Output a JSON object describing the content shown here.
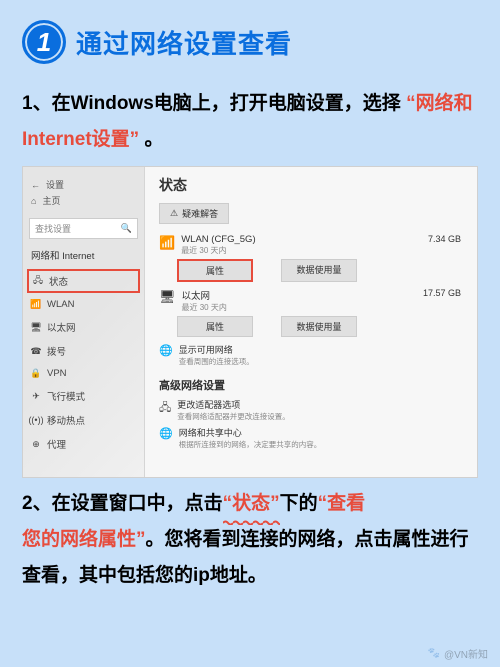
{
  "heading": {
    "number": "1",
    "text": "通过网络设置查看"
  },
  "step1": {
    "prefix": "1、在Windows电脑上，打开电脑设置，选择",
    "highlight": "“网络和Internet设置”",
    "suffix": "。"
  },
  "screenshot": {
    "top": {
      "back": "←",
      "title": "设置",
      "home_icon": "⌂",
      "home": "主页"
    },
    "search_placeholder": "查找设置",
    "category": "网络和 Internet",
    "sidebar_items": [
      {
        "icon": "🖧",
        "label": "状态",
        "active": true
      },
      {
        "icon": "📶",
        "label": "WLAN"
      },
      {
        "icon": "🖥",
        "label": "以太网"
      },
      {
        "icon": "☎",
        "label": "拨号"
      },
      {
        "icon": "🔒",
        "label": "VPN"
      },
      {
        "icon": "✈",
        "label": "飞行模式"
      },
      {
        "icon": "((•))",
        "label": "移动热点"
      },
      {
        "icon": "⊕",
        "label": "代理"
      }
    ],
    "main": {
      "title": "状态",
      "troubleshoot": "疑难解答",
      "networks": [
        {
          "icon": "📶",
          "name": "WLAN (CFG_5G)",
          "sub": "最近 30 天内",
          "gb": "7.34 GB",
          "prop": "属性",
          "usage": "数据使用量",
          "boxed": true
        },
        {
          "icon": "🖥",
          "name": "以太网",
          "sub": "最近 30 天内",
          "gb": "17.57 GB",
          "prop": "属性",
          "usage": "数据使用量",
          "boxed": false
        }
      ],
      "show_available": {
        "icon": "🌐",
        "title": "显示可用网络",
        "sub": "查看周围的连接选项。"
      },
      "advanced_title": "高级网络设置",
      "change_adapter": {
        "icon": "🖧",
        "title": "更改适配器选项",
        "sub": "查看网络适配器并更改连接设置。"
      },
      "sharing_center": {
        "icon": "🌐",
        "title": "网络和共享中心",
        "sub": "根据所连接到的网络，决定要共享的内容。"
      }
    }
  },
  "step2": {
    "t1": "2、在设置窗口中，点击",
    "h1": "“状态”",
    "t2": "下的",
    "h2a": "“查看",
    "h2b": "您的网络属性”",
    "t3": "。您将看到连接的网络，点击属性进行查看，其中包括您的ip地址。"
  },
  "watermark": "@VN新知"
}
